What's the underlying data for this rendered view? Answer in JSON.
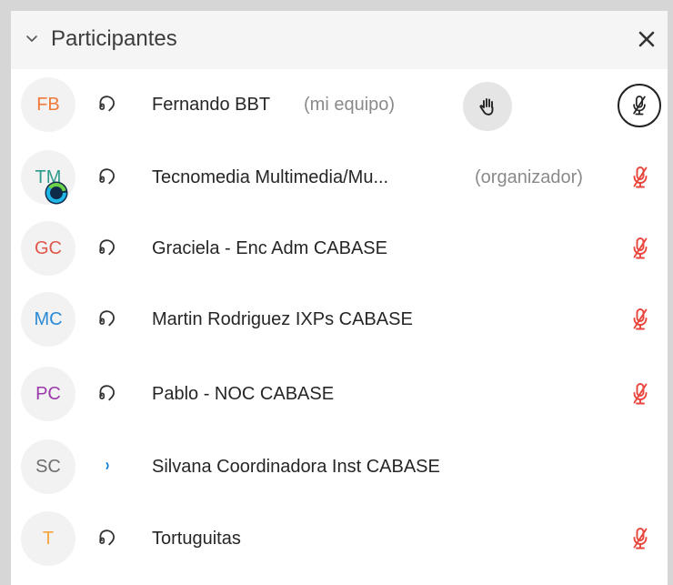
{
  "panel": {
    "title": "Participantes"
  },
  "participants": [
    {
      "initials": "FB",
      "initials_color": "#f07a3a",
      "name": "Fernando BBT",
      "tag": "(mi equipo)",
      "audio": "headset",
      "hand_raised": true,
      "mute_style": "circle"
    },
    {
      "initials": "TM",
      "initials_color": "#2e9a8a",
      "name": "Tecnomedia Multimedia/Mu...",
      "tag": "(organizador)",
      "audio": "headset",
      "webex_badge": true,
      "mute_style": "red"
    },
    {
      "initials": "GC",
      "initials_color": "#e0574a",
      "name": "Graciela - Enc Adm CABASE",
      "tag": "",
      "audio": "headset",
      "mute_style": "red"
    },
    {
      "initials": "MC",
      "initials_color": "#2a8ad6",
      "name": "Martin Rodriguez IXPs CABASE",
      "tag": "",
      "audio": "headset",
      "mute_style": "red"
    },
    {
      "initials": "PC",
      "initials_color": "#9b3aaa",
      "name": "Pablo - NOC CABASE",
      "tag": "",
      "audio": "headset",
      "mute_style": "red"
    },
    {
      "initials": "SC",
      "initials_color": "#6e6e6e",
      "name": "Silvana Coordinadora Inst CABASE",
      "tag": "",
      "audio": "connecting",
      "mute_style": "none"
    },
    {
      "initials": "T",
      "initials_color": "#f5a53a",
      "name": "Tortuguitas",
      "tag": "",
      "audio": "headset",
      "mute_style": "red"
    }
  ],
  "colors": {
    "muted_red": "#e8463c",
    "audio_blue": "#1a7fd6",
    "icon_dark": "#333333"
  },
  "icons": {
    "collapse": "chevron-down-icon",
    "close": "close-icon",
    "audio": "headset-icon",
    "connecting": "audio-connecting-icon",
    "hand": "raised-hand-icon",
    "mute": "microphone-muted-icon",
    "badge": "webex-badge-icon"
  }
}
